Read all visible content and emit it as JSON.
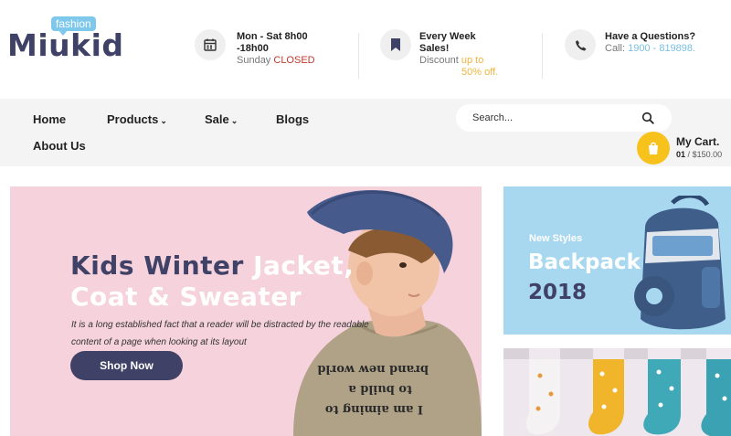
{
  "brand": {
    "badge": "fashion",
    "name": "Miukid"
  },
  "header_info": {
    "hours": {
      "line1": "Mon - Sat 8h00",
      "line2": "-18h00",
      "line3_prefix": "Sunday",
      "line3_status": "CLOSED",
      "icon": "calendar-icon"
    },
    "sales": {
      "line1": "Every Week",
      "line2": "Sales!",
      "line3_prefix": "Discount",
      "line3_value": "up to",
      "line4": "50% off.",
      "icon": "bookmark-icon"
    },
    "contact": {
      "line1": "Have a Questions?",
      "line2_prefix": "Call:",
      "line2_phone": "1900 - 819898.",
      "icon": "phone-icon"
    }
  },
  "nav": {
    "items": [
      {
        "label": "Home"
      },
      {
        "label": "Products",
        "dropdown": true
      },
      {
        "label": "Sale",
        "dropdown": true
      },
      {
        "label": "Blogs"
      },
      {
        "label": "About Us"
      }
    ]
  },
  "search": {
    "placeholder": "Search..."
  },
  "cart": {
    "title": "My Cart.",
    "count": "01",
    "separator": "/",
    "total": "$150.00"
  },
  "hero": {
    "title_dark": "Kids Winter",
    "title_white_1": "Jacket,",
    "title_white_2": "Coat & Sweater",
    "description": "It is a long established fact that a reader will be distracted by the readable content of a page when looking at its layout",
    "button_label": "Shop Now",
    "shirt_text": [
      "I am aiming to",
      "to build a",
      "brand new world"
    ]
  },
  "banner_backpack": {
    "small": "New Styles",
    "big": "Backpack",
    "year": "2018"
  },
  "colors": {
    "brand_dark": "#3f4166",
    "accent_blue": "#7ec8ec",
    "accent_yellow": "#f7c21c",
    "hero_pink": "#f5d2dc",
    "closed_red": "#c0392b"
  }
}
